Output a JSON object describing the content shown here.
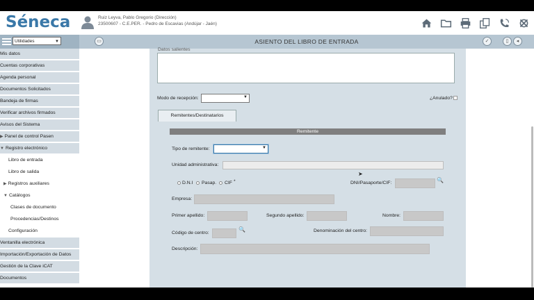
{
  "app": {
    "logo_text": "Séneca",
    "user_name": "Ruiz Leyva, Pablo Gregorio (Dirección)",
    "user_center": "23500607 - C.E.PER. - Pedro de Escavias (Andújar - Jaén)"
  },
  "header_icons": [
    "home-icon",
    "folder-icon",
    "printer-icon",
    "windows-icon",
    "phone-icon",
    "close-icon"
  ],
  "toolbar": {
    "selector_value": "Utilidades",
    "page_title": "ASIENTO DEL LIBRO DE ENTRADA"
  },
  "sidebar": {
    "items": [
      {
        "label": "Mis datos"
      },
      {
        "label": "Cuentas corporativas"
      },
      {
        "label": "Agenda personal"
      },
      {
        "label": "Documentos Solicitados"
      },
      {
        "label": "Bandeja de firmas"
      },
      {
        "label": "Verificar archivos firmados"
      },
      {
        "label": "Avisos del Sistema"
      },
      {
        "label": "Panel de control Pasen"
      },
      {
        "label": "Registro electrónico"
      },
      {
        "label": "Libro de entrada"
      },
      {
        "label": "Libro de salida"
      },
      {
        "label": "Registros auxiliares"
      },
      {
        "label": "Catálogos"
      },
      {
        "label": "Clases de documento"
      },
      {
        "label": "Procedencias/Destinos"
      },
      {
        "label": "Configuración"
      },
      {
        "label": "Ventanilla electrónica"
      },
      {
        "label": "Importación/Exportación de Datos"
      },
      {
        "label": "Gestión de la Clave iCAT"
      },
      {
        "label": "Documentos"
      }
    ]
  },
  "form": {
    "top_label_partial": "Datos salientes",
    "modo_label": "Modo de recepción:",
    "anulado_label": "¿Anulado?",
    "tab_label": "Remitentes/Destinatarios",
    "section_title": "Remitente",
    "tipo_label": "Tipo de remitente:",
    "unidad_label": "Unidad administrativa:",
    "radio_dni": "D.N.I",
    "radio_pasap": "Pasap.",
    "radio_cif": "CIF",
    "required_mark": "*",
    "dni_label": "DNI/Pasaporte/CIF:",
    "empresa_label": "Empresa:",
    "primer_label": "Primer apellido:",
    "segundo_label": "Segundo apellido:",
    "nombre_label": "Nombre:",
    "codigo_label": "Código de centro:",
    "denominacion_label": "Denominación del centro:",
    "descripcion_label": "Descripción:"
  }
}
